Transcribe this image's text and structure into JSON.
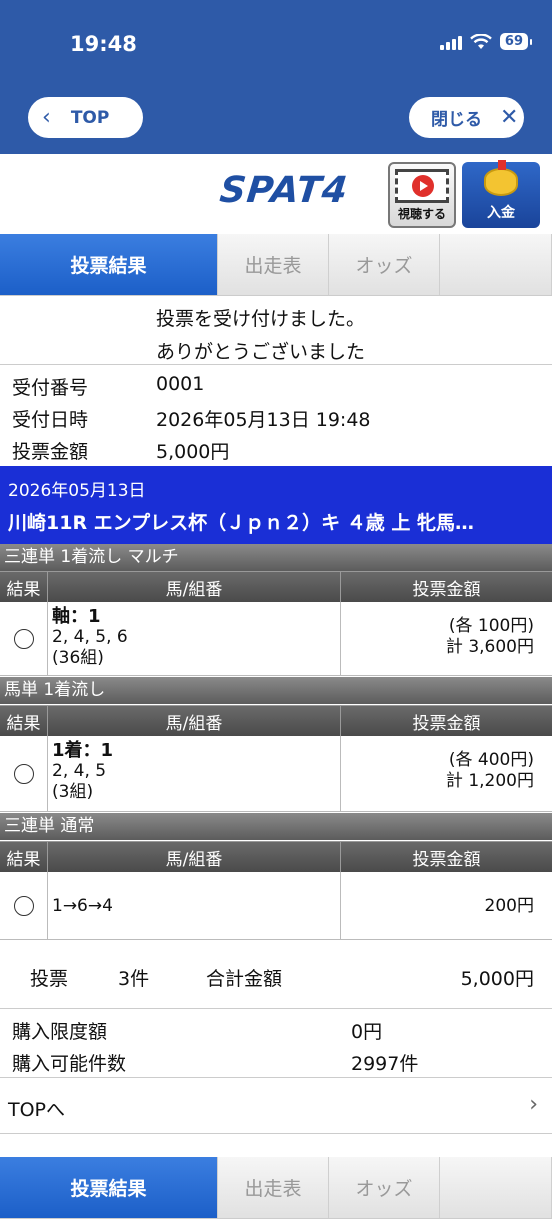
{
  "status": {
    "time": "19:48",
    "battery": "69"
  },
  "header": {
    "back_label": "TOP",
    "back_icon": "chevron-left-icon",
    "close_label": "閉じる",
    "close_icon": "close-icon"
  },
  "brand": {
    "logo": "SPAT4",
    "watch_label": "視聴する",
    "deposit_label": "入金"
  },
  "tabs": [
    {
      "label": "投票結果"
    },
    {
      "label": "出走表"
    },
    {
      "label": "オッズ"
    }
  ],
  "message": {
    "line1": "投票を受け付けました。",
    "line2": "ありがとうございました"
  },
  "receipt": {
    "number_label": "受付番号",
    "number": "0001",
    "datetime_label": "受付日時",
    "datetime": "2026年05月13日 19:48",
    "amount_label": "投票金額",
    "amount": "5,000円"
  },
  "race": {
    "date": "2026年05月13日",
    "name": "川崎11R エンプレス杯（Ｊｐｎ２）キ ４歳 上 牝馬…"
  },
  "columns": {
    "result": "結果",
    "combo": "馬/組番",
    "amount": "投票金額"
  },
  "bets": [
    {
      "type": "三連単 1着流し マルチ",
      "result": "○",
      "combo_head": "軸：1",
      "combo_line": "2, 4, 5, 6",
      "combo_count": "(36組)",
      "each": "(各 100円)",
      "total": "計 3,600円"
    },
    {
      "type": "馬単 1着流し",
      "result": "○",
      "combo_head": "1着：1",
      "combo_line": "2, 4, 5",
      "combo_count": "(3組)",
      "each": "(各 400円)",
      "total": "計 1,200円"
    },
    {
      "type": "三連単 通常",
      "result": "○",
      "combo_line": "1→6→4",
      "amount": "200円"
    }
  ],
  "summary": {
    "votes_label": "投票",
    "votes": "3件",
    "total_label": "合計金額",
    "total": "5,000円"
  },
  "limits": {
    "limit_label": "購入限度額",
    "limit": "0円",
    "count_label": "購入可能件数",
    "count": "2997件"
  },
  "nav": {
    "top_link": "TOPへ"
  },
  "colors": {
    "header_blue": "#2e5aa8",
    "race_blue": "#1a2fd6",
    "tab_active": "#2a6fd6"
  }
}
